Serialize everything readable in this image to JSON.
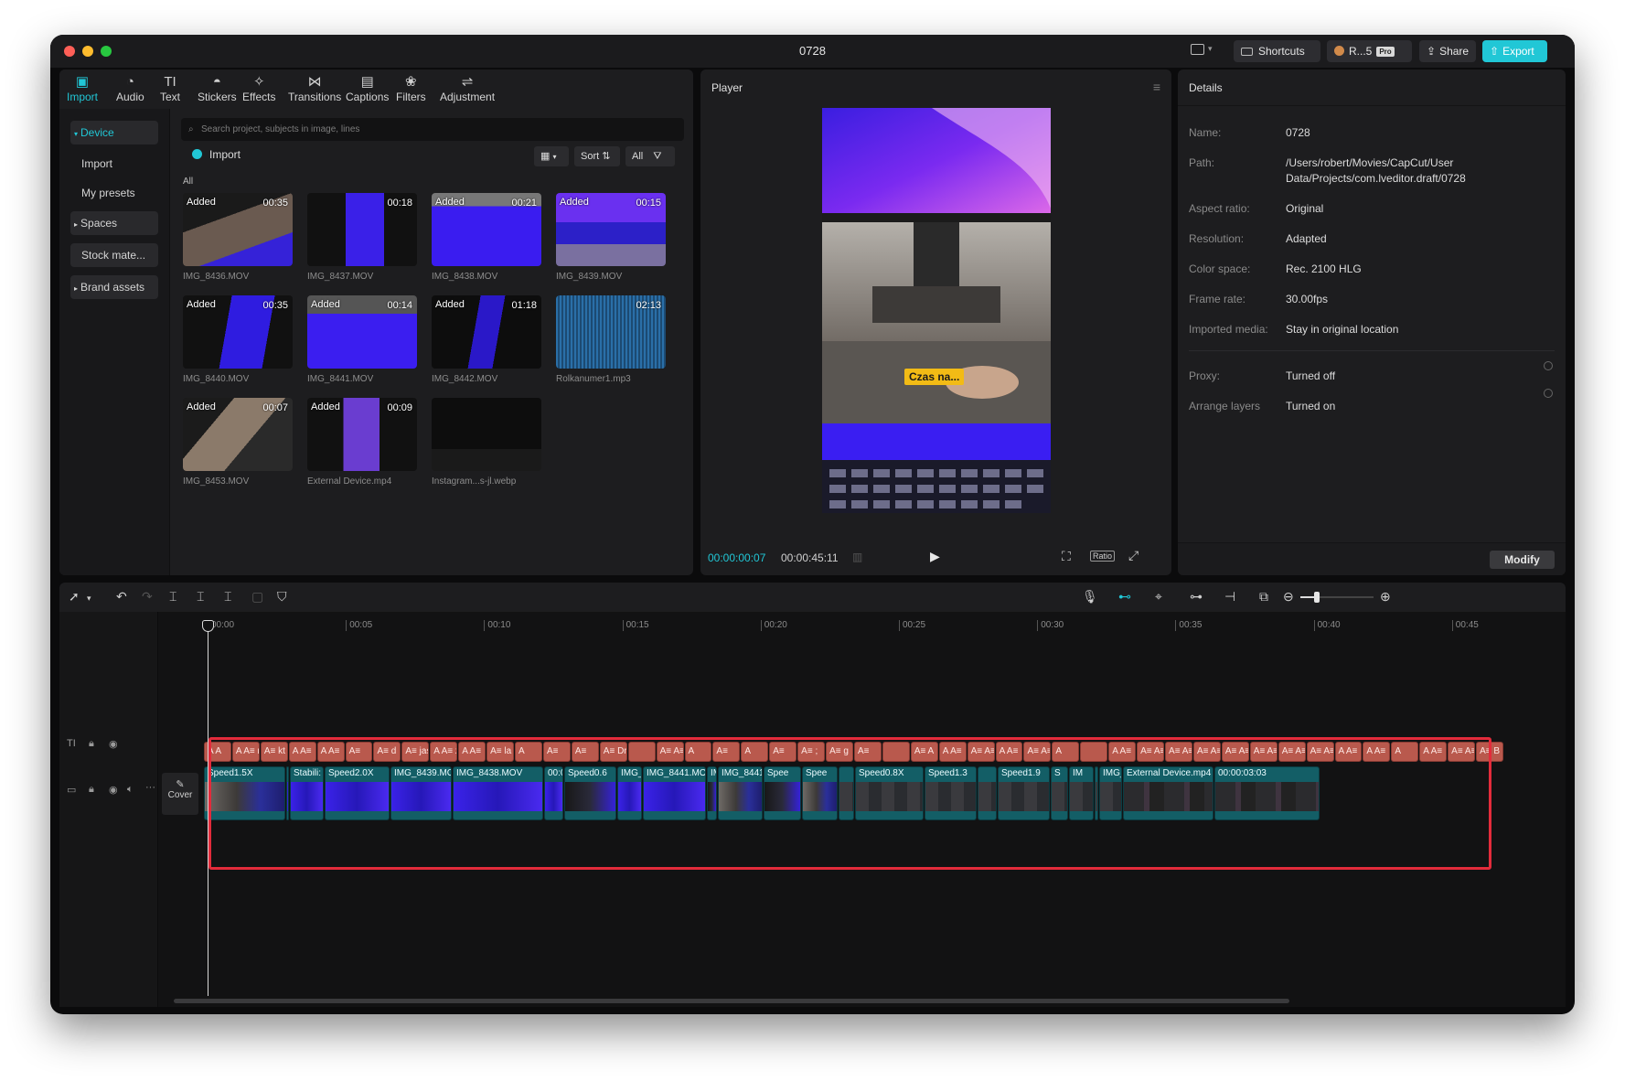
{
  "window": {
    "title": "0728"
  },
  "titlebar": {
    "shortcuts_label": "Shortcuts",
    "account_label": "R...5",
    "pro_label": "Pro",
    "share_label": "Share",
    "export_label": "Export",
    "export_color": "#21c7d6"
  },
  "media_tabs": [
    {
      "label": "Import",
      "icon": "import-icon",
      "glyph": "▣",
      "active": true
    },
    {
      "label": "Audio",
      "icon": "audio-icon",
      "glyph": "◔"
    },
    {
      "label": "Text",
      "icon": "text-icon",
      "glyph": "TI"
    },
    {
      "label": "Stickers",
      "icon": "sticker-icon",
      "glyph": "◓"
    },
    {
      "label": "Effects",
      "icon": "effects-icon",
      "glyph": "✧"
    },
    {
      "label": "Transitions",
      "icon": "transitions-icon",
      "glyph": "⋈"
    },
    {
      "label": "Captions",
      "icon": "captions-icon",
      "glyph": "▤"
    },
    {
      "label": "Filters",
      "icon": "filters-icon",
      "glyph": "❀"
    },
    {
      "label": "Adjustment",
      "icon": "adjustment-icon",
      "glyph": "⇌"
    }
  ],
  "sidebar": {
    "device": "Device",
    "import": "Import",
    "my_presets": "My presets",
    "spaces": "Spaces",
    "stock": "Stock mate...",
    "brand": "Brand assets"
  },
  "search": {
    "placeholder": "Search project, subjects in image, lines"
  },
  "media_toolbar": {
    "import_label": "Import",
    "sort_label": "Sort",
    "filter_label": "All",
    "all_heading": "All"
  },
  "media_items": [
    {
      "name": "IMG_8436.MOV",
      "duration": "00:35",
      "added": "Added"
    },
    {
      "name": "IMG_8437.MOV",
      "duration": "00:18",
      "added": ""
    },
    {
      "name": "IMG_8438.MOV",
      "duration": "00:21",
      "added": "Added"
    },
    {
      "name": "IMG_8439.MOV",
      "duration": "00:15",
      "added": "Added"
    },
    {
      "name": "IMG_8440.MOV",
      "duration": "00:35",
      "added": "Added"
    },
    {
      "name": "IMG_8441.MOV",
      "duration": "00:14",
      "added": "Added"
    },
    {
      "name": "IMG_8442.MOV",
      "duration": "01:18",
      "added": "Added"
    },
    {
      "name": "Rolkanumer1.mp3",
      "duration": "02:13",
      "added": ""
    },
    {
      "name": "IMG_8453.MOV",
      "duration": "00:07",
      "added": "Added"
    },
    {
      "name": "External Device.mp4",
      "duration": "00:09",
      "added": "Added"
    },
    {
      "name": "Instagram...s-jl.webp",
      "duration": "",
      "added": ""
    }
  ],
  "player": {
    "title": "Player",
    "caption": "Czas na...",
    "current_time": "00:00:00:07",
    "total_time": "00:00:45:11",
    "ratio_label": "Ratio"
  },
  "details": {
    "title": "Details",
    "rows": [
      {
        "label": "Name:",
        "value": "0728"
      },
      {
        "label": "Path:",
        "value": "/Users/robert/Movies/CapCut/User Data/Projects/com.lveditor.draft/0728"
      },
      {
        "label": "Aspect ratio:",
        "value": "Original"
      },
      {
        "label": "Resolution:",
        "value": "Adapted"
      },
      {
        "label": "Color space:",
        "value": "Rec. 2100 HLG"
      },
      {
        "label": "Frame rate:",
        "value": "30.00fps"
      },
      {
        "label": "Imported media:",
        "value": "Stay in original location"
      },
      {
        "label": "Proxy:",
        "value": "Turned off"
      },
      {
        "label": "Arrange layers",
        "value": "Turned on"
      }
    ],
    "modify_label": "Modify"
  },
  "timeline": {
    "ruler": [
      "00:00",
      "00:05",
      "00:10",
      "00:15",
      "00:20",
      "00:25",
      "00:30",
      "00:35",
      "00:40",
      "00:45"
    ],
    "cover_label": "Cover",
    "text_segments": [
      "A A",
      "A A≡ n",
      "A≡ kt",
      "A A≡",
      "A A≡",
      "A≡",
      "A≡ d",
      "A≡ jas",
      "A A≡ zew",
      "A A≡",
      "A≡ la",
      "A",
      "A≡",
      "A≡",
      "A≡ Dr",
      "",
      "A≡ A≡ Z",
      "A",
      "A≡",
      "A",
      "A≡",
      "A≡ ;",
      "A≡ g",
      "A≡",
      "",
      "A≡ A",
      "A A≡",
      "A≡ A≡",
      "A A≡",
      "A≡ A≡",
      "A",
      "",
      "A A≡",
      "A≡ A≡",
      "A≡ A≡",
      "A≡ A≡",
      "A≡ A≡",
      "A≡ A≡",
      "A≡ A≡",
      "A≡ A≡",
      "A A≡",
      "A A≡",
      "A",
      "A A≡",
      "A≡ A≡",
      "A≡ B"
    ],
    "video_clips": [
      {
        "label": "Speed1.5X",
        "tone": "room"
      },
      {
        "label": "S",
        "tone": "blue"
      },
      {
        "label": "Stabili:",
        "tone": "blue"
      },
      {
        "label": "Speed2.0X",
        "tone": "blue"
      },
      {
        "label": "IMG_8439.MO",
        "tone": "blue"
      },
      {
        "label": "IMG_8438.MOV",
        "tone": "blue"
      },
      {
        "label": "00:0",
        "tone": "blue"
      },
      {
        "label": "Speed0.6",
        "tone": "dark"
      },
      {
        "label": "IMG_",
        "tone": "blue"
      },
      {
        "label": "IMG_8441.MOV",
        "tone": "blue"
      },
      {
        "label": "IM",
        "tone": "dark"
      },
      {
        "label": "IMG_8441",
        "tone": "room"
      },
      {
        "label": "Spee",
        "tone": "dark"
      },
      {
        "label": "Spee",
        "tone": "room"
      },
      {
        "label": "",
        "tone": "gray"
      },
      {
        "label": "Speed0.8X",
        "tone": "gray"
      },
      {
        "label": "Speed1.3",
        "tone": "gray"
      },
      {
        "label": "",
        "tone": "gray"
      },
      {
        "label": "Speed1.9",
        "tone": "gray"
      },
      {
        "label": "S",
        "tone": "gray"
      },
      {
        "label": "IM",
        "tone": "gray"
      },
      {
        "label": "",
        "tone": "gray"
      },
      {
        "label": "IMG_",
        "tone": "gray"
      },
      {
        "label": "External Device.mp4",
        "tone": "phone"
      },
      {
        "label": "00:00:03:03",
        "tone": "phone"
      }
    ]
  }
}
